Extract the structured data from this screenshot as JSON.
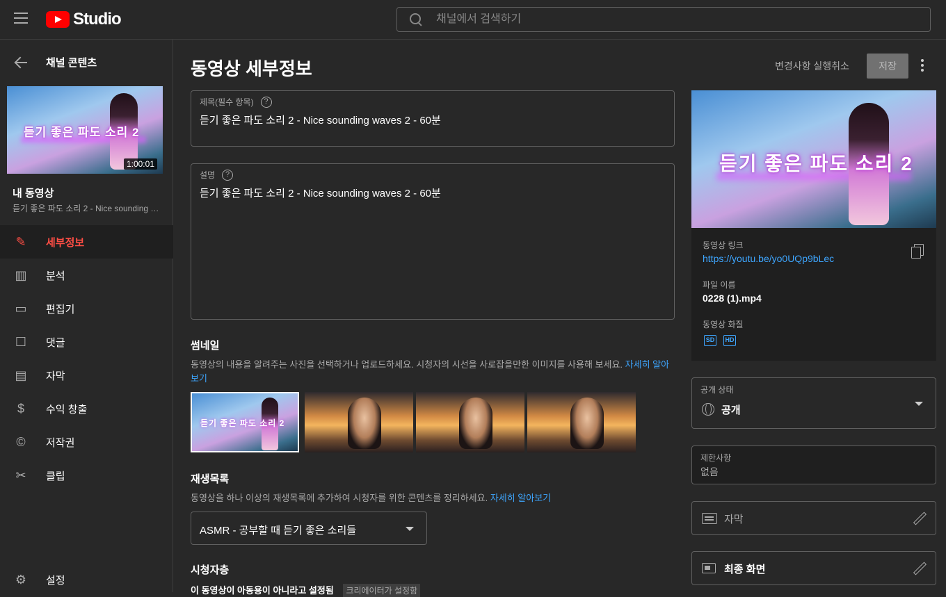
{
  "header": {
    "logo_text": "Studio",
    "search_placeholder": "채널에서 검색하기"
  },
  "sidebar": {
    "back_label": "채널 콘텐츠",
    "thumbnail_title": "듣기 좋은 파도 소리 2",
    "thumbnail_duration": "1:00:01",
    "my_video_label": "내 동영상",
    "video_subtitle": "듣기 좋은 파도 소리 2 - Nice sounding waves 2 - 60분",
    "items": [
      {
        "label": "세부정보",
        "icon": "pencil-icon",
        "active": true
      },
      {
        "label": "분석",
        "icon": "analytics-icon",
        "active": false
      },
      {
        "label": "편집기",
        "icon": "editor-icon",
        "active": false
      },
      {
        "label": "댓글",
        "icon": "comments-icon",
        "active": false
      },
      {
        "label": "자막",
        "icon": "subtitles-icon",
        "active": false
      },
      {
        "label": "수익 창출",
        "icon": "dollar-icon",
        "active": false
      },
      {
        "label": "저작권",
        "icon": "copyright-icon",
        "active": false
      },
      {
        "label": "클립",
        "icon": "scissors-icon",
        "active": false
      }
    ],
    "settings_label": "설정"
  },
  "main": {
    "page_title": "동영상 세부정보",
    "undo_label": "변경사항 실행취소",
    "save_label": "저장",
    "title_field": {
      "label": "제목(필수 항목)",
      "value": "듣기 좋은 파도 소리 2 - Nice sounding waves 2 - 60분"
    },
    "description_field": {
      "label": "설명",
      "value": "듣기 좋은 파도 소리 2 - Nice sounding waves 2 - 60분"
    },
    "thumbnail_section": {
      "title": "썸네일",
      "description": "동영상의 내용을 알려주는 사진을 선택하거나 업로드하세요. 시청자의 시선을 사로잡을만한 이미지를 사용해 보세요.",
      "link": "자세히 알아보기"
    },
    "playlist_section": {
      "title": "재생목록",
      "description": "동영상을 하나 이상의 재생목록에 추가하여 시청자를 위한 콘텐츠를 정리하세요.",
      "link": "자세히 알아보기",
      "selected": "ASMR - 공부할 때 듣기 좋은 소리들"
    },
    "audience_section": {
      "title": "시청자층",
      "status_text": "이 동영상이 아동용이 아니라고 설정됨",
      "chip": "크리에이터가 설정함"
    }
  },
  "right_panel": {
    "thumbnail_title": "듣기 좋은 파도 소리 2",
    "video_link_label": "동영상 링크",
    "video_link": "https://youtu.be/yo0UQp9bLec",
    "file_name_label": "파일 이름",
    "file_name": "0228 (1).mp4",
    "quality_label": "동영상 화질",
    "quality_badges": [
      "SD",
      "HD"
    ],
    "visibility_label": "공개 상태",
    "visibility_value": "공개",
    "restrictions_label": "제한사항",
    "restrictions_value": "없음",
    "subtitles_label": "자막",
    "end_screen_label": "최종 화면"
  },
  "colors": {
    "background": "#282828",
    "active_red": "#ff4e45",
    "link_blue": "#3ea6ff",
    "brand_red": "#ff0000"
  }
}
